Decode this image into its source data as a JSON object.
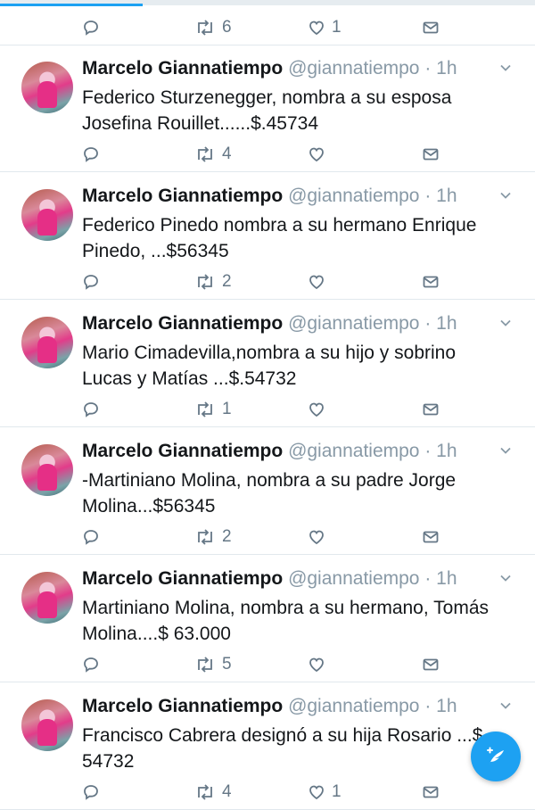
{
  "top_actions": {
    "retweets": "6",
    "likes": "1"
  },
  "tweets": [
    {
      "name": "Marcelo Giannatiempo",
      "handle": "@giannatiempo",
      "time": "· 1h",
      "text": "Federico Sturzenegger, nombra a su esposa Josefina Rouillet......$.45734",
      "retweets": "4",
      "likes": ""
    },
    {
      "name": "Marcelo Giannatiempo",
      "handle": "@giannatiempo",
      "time": "· 1h",
      "text": "Federico Pinedo nombra a su hermano Enrique Pinedo, ...$56345",
      "retweets": "2",
      "likes": ""
    },
    {
      "name": "Marcelo Giannatiempo",
      "handle": "@giannatiempo",
      "time": "· 1h",
      "text": "Mario Cimadevilla,nombra a su hijo y sobrino Lucas y Matías ...$.54732",
      "retweets": "1",
      "likes": ""
    },
    {
      "name": "Marcelo Giannatiempo",
      "handle": "@giannatiempo",
      "time": "· 1h",
      "text": "-Martiniano Molina, nombra a su padre Jorge Molina...$56345",
      "retweets": "2",
      "likes": ""
    },
    {
      "name": "Marcelo Giannatiempo",
      "handle": "@giannatiempo",
      "time": "· 1h",
      "text": "Martiniano Molina, nombra a su hermano, Tomás Molina....$ 63.000",
      "retweets": "5",
      "likes": ""
    },
    {
      "name": "Marcelo Giannatiempo",
      "handle": "@giannatiempo",
      "time": "· 1h",
      "text": "Francisco Cabrera designó a su hija Rosario ...$ 54732",
      "retweets": "4",
      "likes": "1"
    }
  ],
  "colors": {
    "accent": "#1da1f2",
    "muted": "#657786",
    "divider": "#e1e8ed"
  },
  "icons": [
    "reply-icon",
    "retweet-icon",
    "like-icon",
    "message-icon",
    "chevron-down-icon",
    "compose-icon"
  ]
}
